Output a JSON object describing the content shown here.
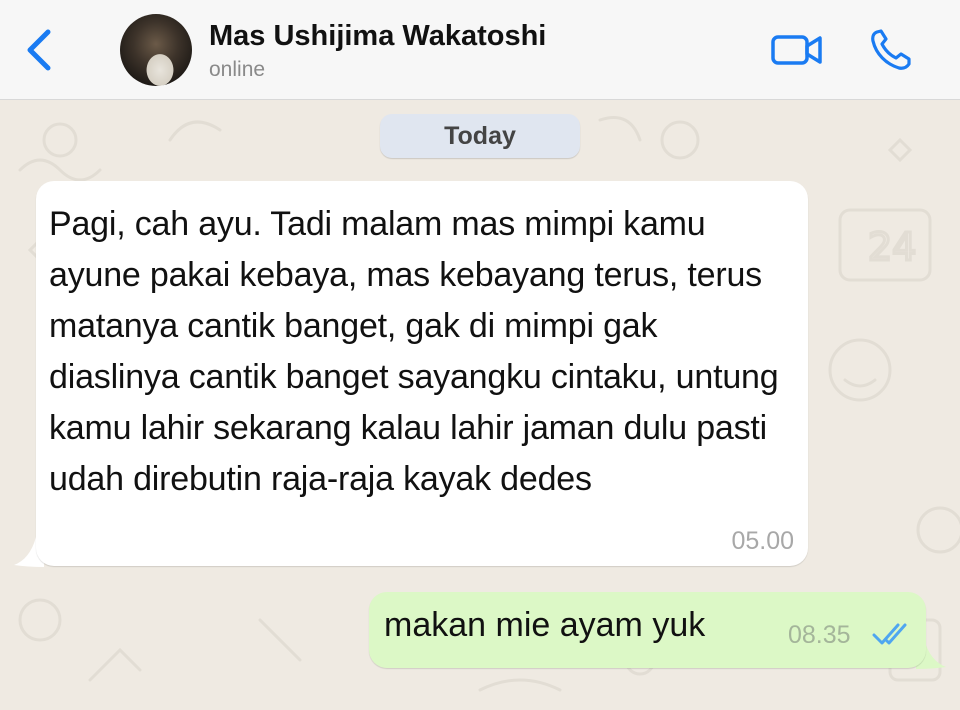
{
  "header": {
    "back_icon": "chevron-left-icon",
    "contact_name": "Mas Ushijima Wakatoshi",
    "status": "online",
    "video_icon": "video-camera-icon",
    "call_icon": "phone-icon",
    "accent_color": "#1a7bf2"
  },
  "chat": {
    "date_separator": "Today",
    "messages": [
      {
        "direction": "incoming",
        "text": "Pagi, cah ayu. Tadi malam mas mimpi kamu ayune pakai kebaya, mas kebayang terus, terus matanya cantik banget, gak di mimpi gak diaslinya cantik banget sayangku cintaku, untung kamu lahir sekarang kalau lahir jaman dulu pasti udah direbutin raja-raja kayak dedes",
        "time": "05.00",
        "bubble_color": "#ffffff"
      },
      {
        "direction": "outgoing",
        "text": "makan mie ayam yuk",
        "time": "08.35",
        "status_icon": "double-check-icon",
        "status_color": "#4fa6f0",
        "bubble_color": "#dcf8c6"
      }
    ]
  }
}
